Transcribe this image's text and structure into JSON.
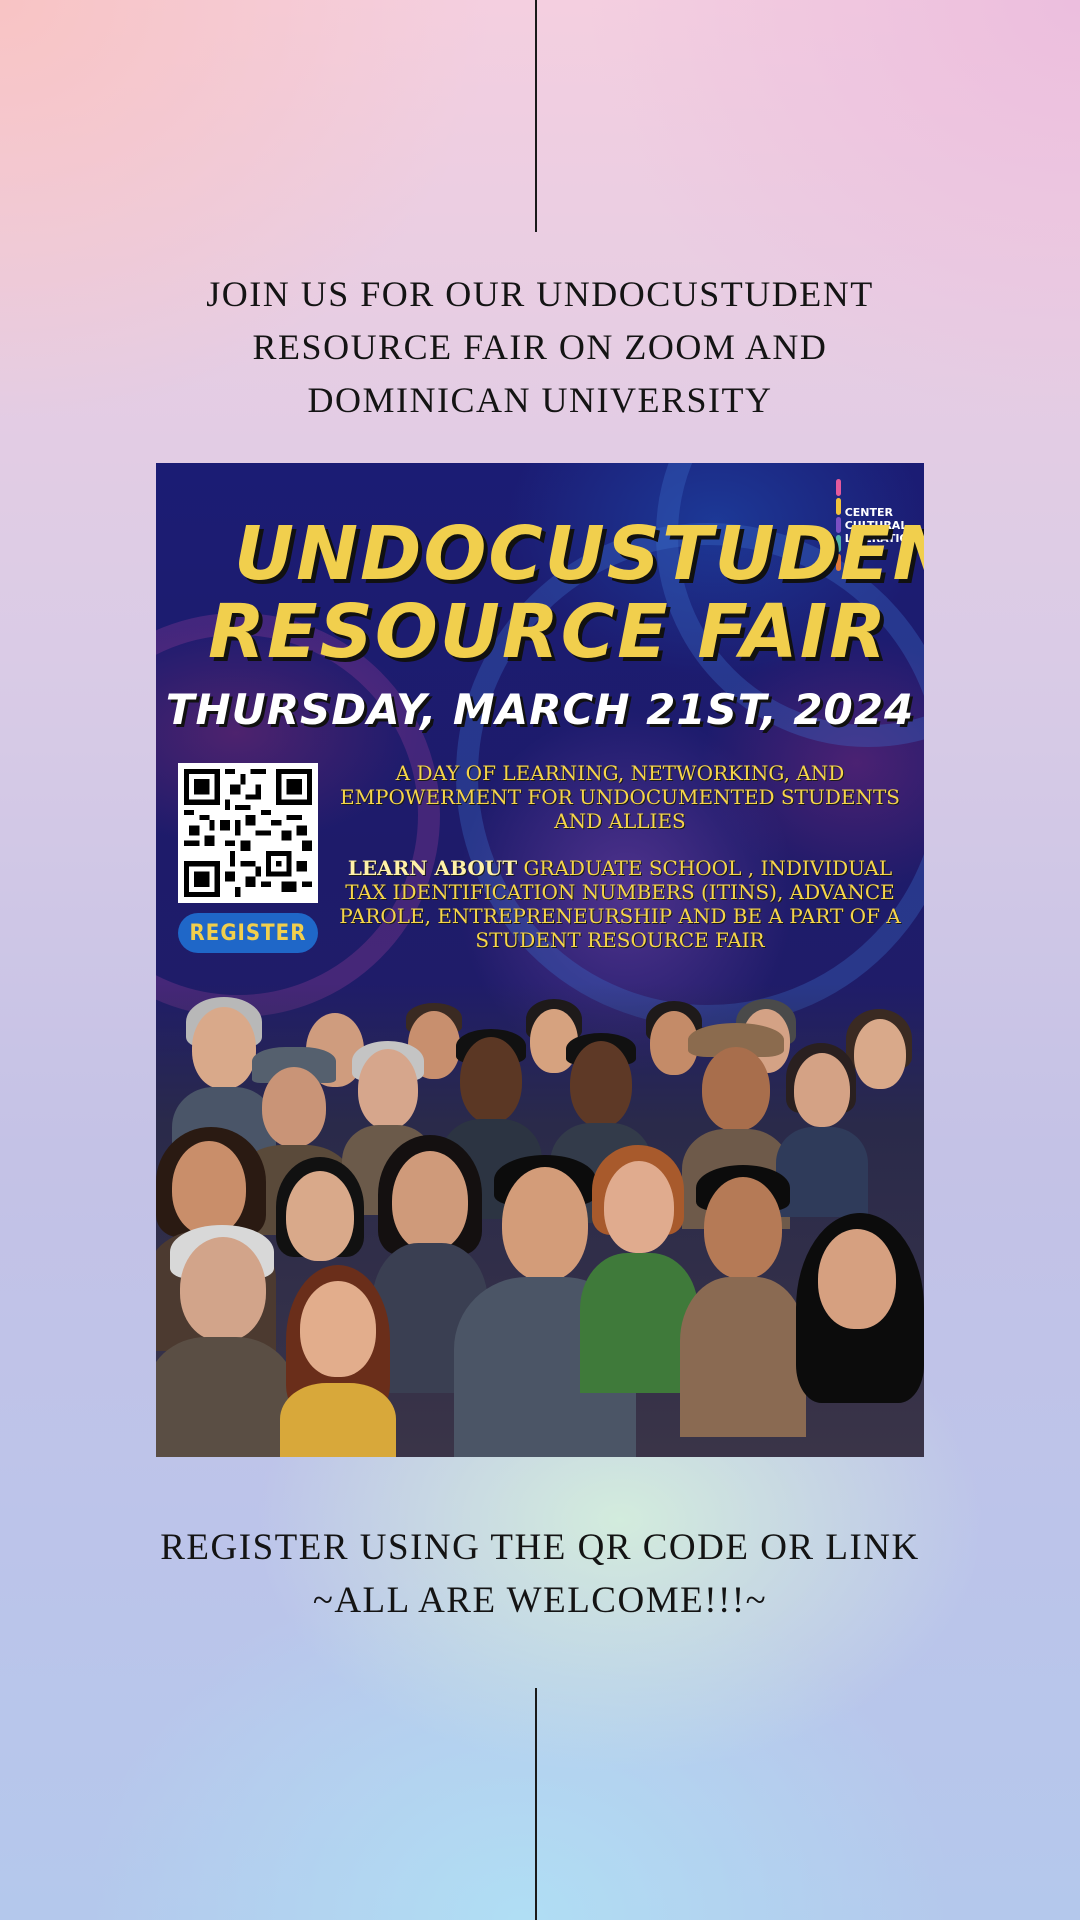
{
  "header": {
    "caption_lines": [
      "JOIN US FOR OUR UNDOCUSTUDENT",
      "RESOURCE FAIR ON ZOOM AND",
      "DOMINICAN UNIVERSITY"
    ]
  },
  "poster": {
    "title_line1": "UNDOCUSTUDENT",
    "title_line2": "RESOURCE FAIR",
    "date": "THURSDAY, MARCH 21ST, 2024",
    "logo_lines": [
      "CENTER",
      "CULTURAL",
      "LIBERATION"
    ],
    "logo_small": "for",
    "register_label": "REGISTER",
    "description1": "A DAY OF LEARNING, NETWORKING, AND EMPOWERMENT FOR UNDOCUMENTED STUDENTS AND ALLIES",
    "description2_lead": "LEARN ABOUT",
    "description2_rest": " GRADUATE SCHOOL , INDIVIDUAL TAX IDENTIFICATION NUMBERS (ITINS), ADVANCE PAROLE, ENTREPRENEURSHIP AND BE A PART OF A STUDENT RESOURCE FAIR",
    "colors": {
      "title": "#f1cf4d",
      "background": "#1b1c74",
      "button": "#1f67c8"
    }
  },
  "footer": {
    "caption_lines": [
      "REGISTER USING THE QR CODE OR LINK",
      "~ALL ARE WELCOME!!!~"
    ]
  }
}
